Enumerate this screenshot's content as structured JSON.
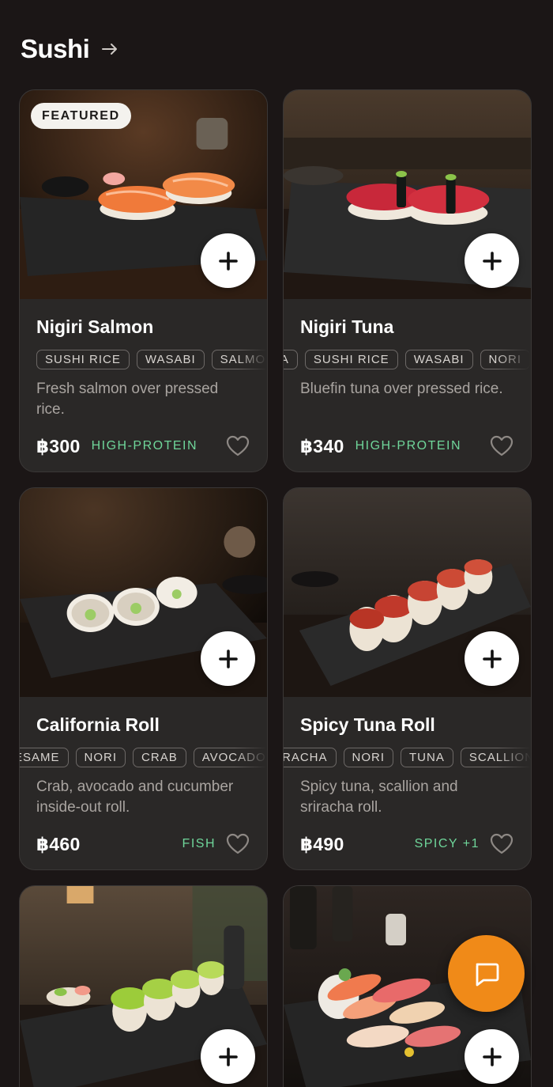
{
  "section": {
    "title": "Sushi",
    "arrow_icon": "arrow-right-icon"
  },
  "badge": {
    "featured": "FEATURED"
  },
  "colors": {
    "background": "#1b1616",
    "card": "#2a2827",
    "diet_tag": "#6fd69a",
    "chat_fab": "#f08a18"
  },
  "products": [
    {
      "name": "Nigiri Salmon",
      "tags": [
        "SUSHI RICE",
        "WASABI",
        "SALMON"
      ],
      "description": "Fresh salmon over pressed rice.",
      "price": "฿300",
      "diet": "HIGH-PROTEIN",
      "featured": true
    },
    {
      "name": "Nigiri Tuna",
      "tags": [
        "TUNA",
        "SUSHI RICE",
        "WASABI",
        "NORI"
      ],
      "description": "Bluefin tuna over pressed rice.",
      "price": "฿340",
      "diet": "HIGH-PROTEIN",
      "featured": false
    },
    {
      "name": "California Roll",
      "tags": [
        "SESAME",
        "NORI",
        "CRAB",
        "AVOCADO"
      ],
      "description": "Crab, avocado and cucumber inside-out roll.",
      "price": "฿460",
      "diet": "FISH",
      "featured": false
    },
    {
      "name": "Spicy Tuna Roll",
      "tags": [
        "SRIRACHA",
        "NORI",
        "TUNA",
        "SCALLION"
      ],
      "description": "Spicy tuna, scallion and sriracha roll.",
      "price": "฿490",
      "diet": "SPICY +1",
      "featured": false
    }
  ],
  "icons": {
    "add": "plus-icon",
    "favorite": "heart-icon",
    "chat": "chat-bubble-icon"
  }
}
